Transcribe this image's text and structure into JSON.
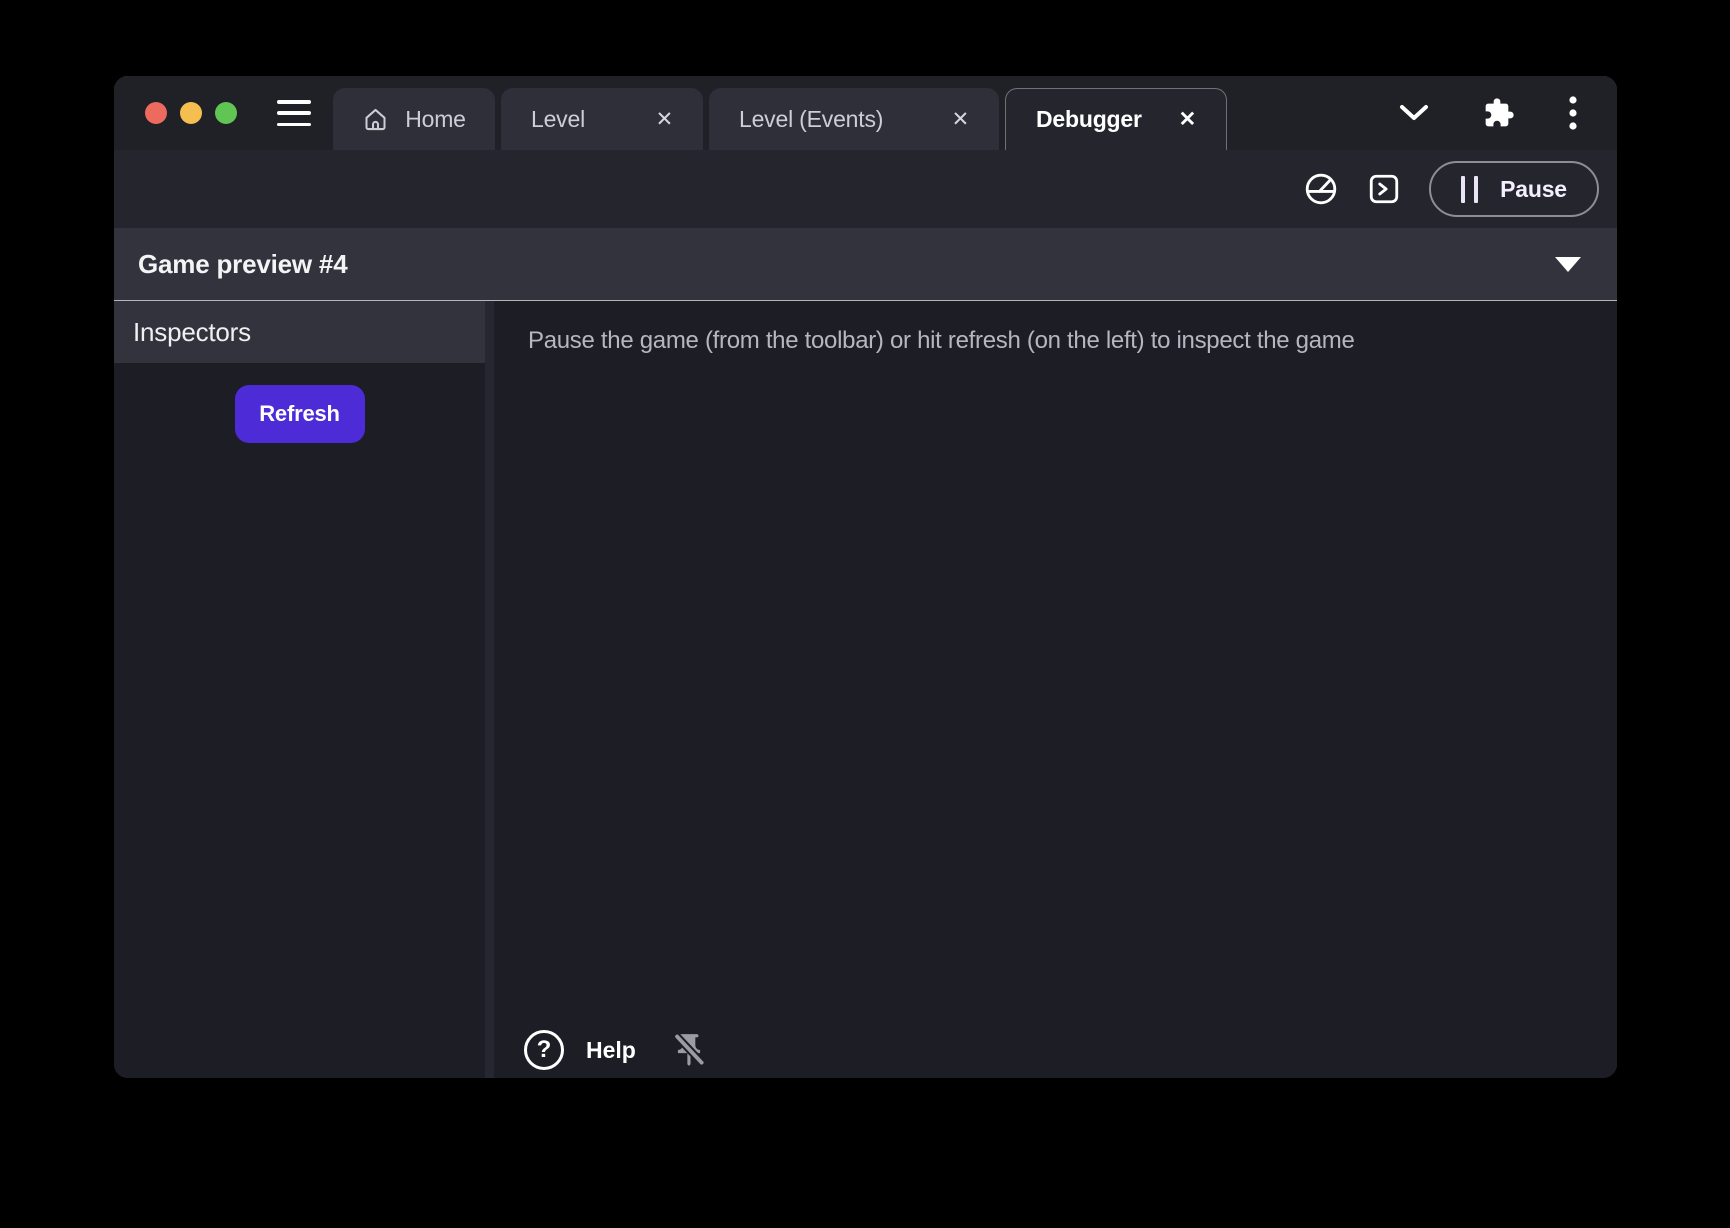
{
  "titlebar": {
    "tabs": [
      {
        "label": "Home"
      },
      {
        "label": "Level"
      },
      {
        "label": "Level (Events)"
      },
      {
        "label": "Debugger"
      }
    ]
  },
  "toolbar": {
    "pause_label": "Pause"
  },
  "preview": {
    "title": "Game preview #4"
  },
  "sidebar": {
    "header": "Inspectors",
    "refresh_label": "Refresh"
  },
  "main": {
    "message": "Pause the game (from the toolbar) or hit refresh (on the left) to inspect the game",
    "help_label": "Help"
  },
  "icons": {
    "close": "✕",
    "question": "?"
  },
  "colors": {
    "accent": "#4D2BD6",
    "window_bg": "#1d1d25",
    "titlebar_bg": "#202027",
    "toolbar_bg": "#25252d",
    "panel_header_bg": "#33333d",
    "tab_inactive_bg": "#2f2f39",
    "traffic_red": "#ED6A5E",
    "traffic_yellow": "#F4BF4F",
    "traffic_green": "#61C554"
  }
}
